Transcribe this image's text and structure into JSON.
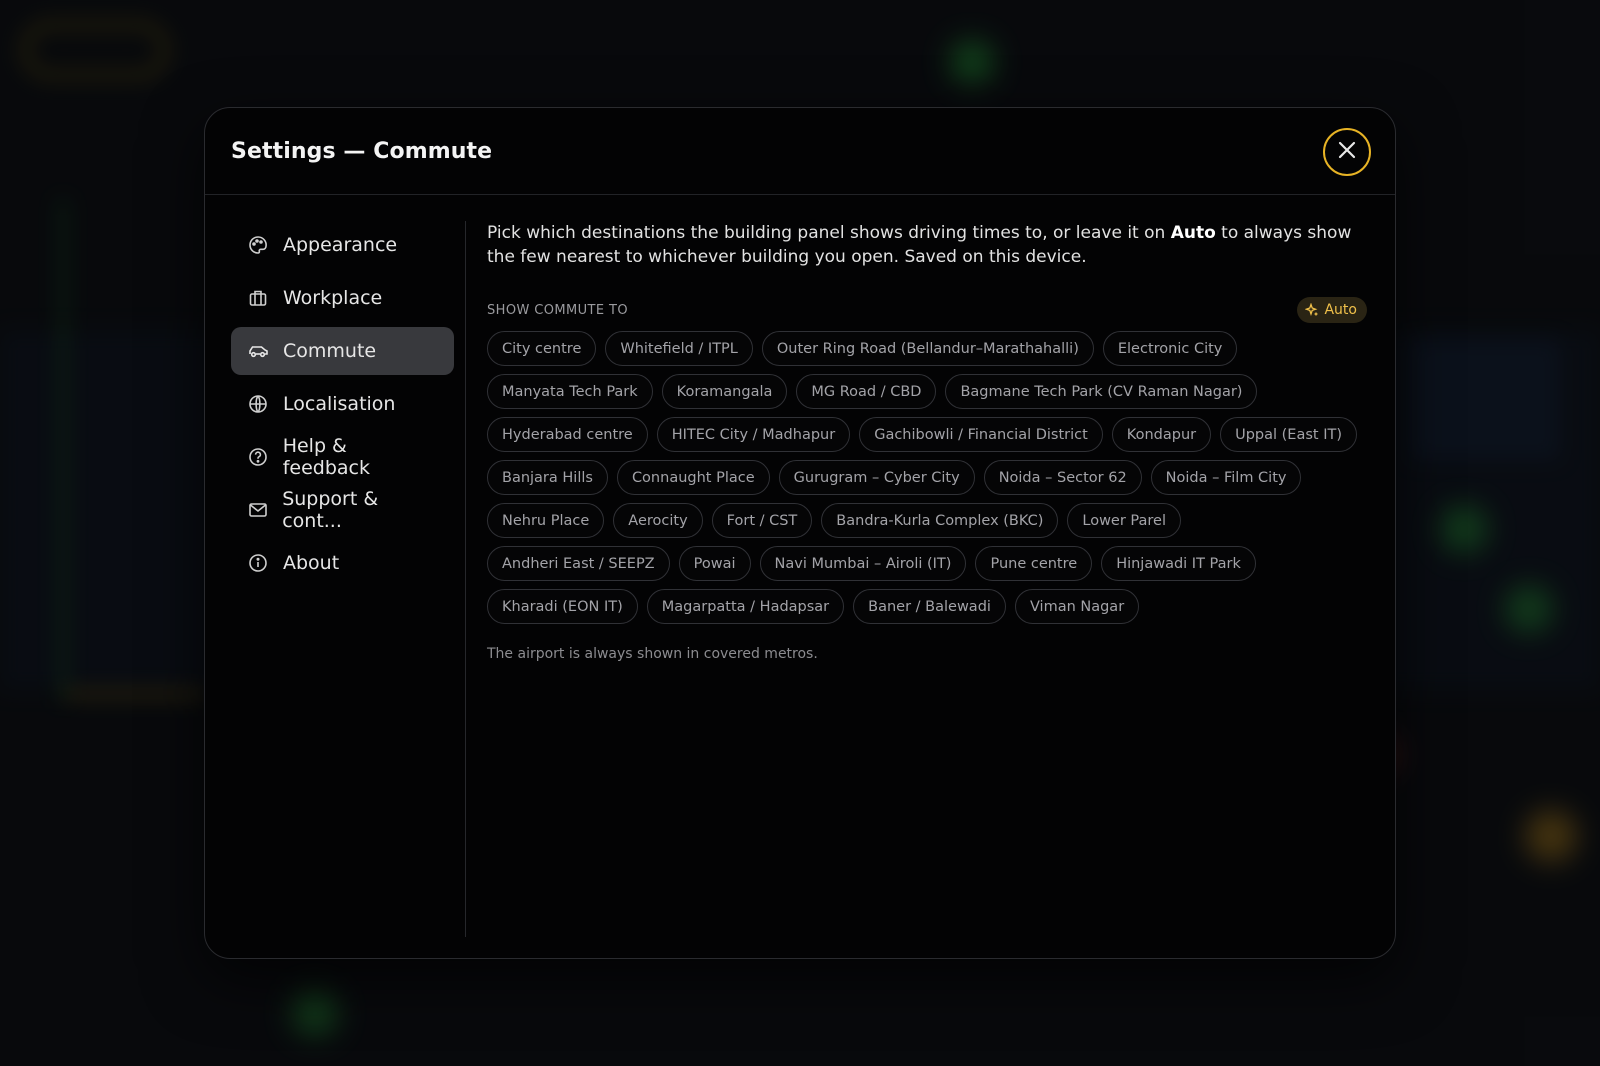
{
  "modal": {
    "title": "Settings — Commute",
    "accent": "#e7b325"
  },
  "sidebar": {
    "items": [
      {
        "label": "Appearance",
        "icon": "palette-icon",
        "active": false
      },
      {
        "label": "Workplace",
        "icon": "briefcase-icon",
        "active": false
      },
      {
        "label": "Commute",
        "icon": "car-icon",
        "active": true
      },
      {
        "label": "Localisation",
        "icon": "globe-icon",
        "active": false
      },
      {
        "label": "Help & feedback",
        "icon": "help-circle-icon",
        "active": false
      },
      {
        "label": "Support & cont...",
        "icon": "mail-icon",
        "active": false
      },
      {
        "label": "About",
        "icon": "info-icon",
        "active": false
      }
    ]
  },
  "commute": {
    "intro_part1": "Pick which destinations the building panel shows driving times to, or leave it on ",
    "intro_bold": "Auto",
    "intro_part2": " to always show the few nearest to whichever building you open. Saved on this device.",
    "section_label": "SHOW COMMUTE TO",
    "auto_badge": "Auto",
    "destinations": [
      "City centre",
      "Whitefield / ITPL",
      "Outer Ring Road (Bellandur–Marathahalli)",
      "Electronic City",
      "Manyata Tech Park",
      "Koramangala",
      "MG Road / CBD",
      "Bagmane Tech Park (CV Raman Nagar)",
      "Hyderabad centre",
      "HITEC City / Madhapur",
      "Gachibowli / Financial District",
      "Kondapur",
      "Uppal (East IT)",
      "Banjara Hills",
      "Connaught Place",
      "Gurugram – Cyber City",
      "Noida – Sector 62",
      "Noida – Film City",
      "Nehru Place",
      "Aerocity",
      "Fort / CST",
      "Bandra-Kurla Complex (BKC)",
      "Lower Parel",
      "Andheri East / SEEPZ",
      "Powai",
      "Navi Mumbai – Airoli (IT)",
      "Pune centre",
      "Hinjawadi IT Park",
      "Kharadi (EON IT)",
      "Magarpatta / Hadapsar",
      "Baner / Balewadi",
      "Viman Nagar"
    ],
    "footnote": "The airport is always shown in covered metros."
  }
}
